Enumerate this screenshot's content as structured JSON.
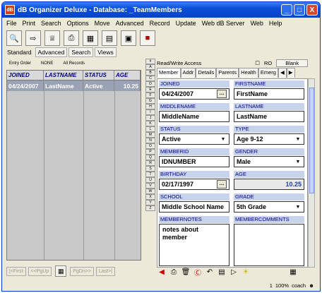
{
  "app": {
    "title": "dB Organizer Deluxe - Database: _TeamMembers",
    "minimize": "_",
    "maximize": "□",
    "close": "X",
    "icon": "app-icon"
  },
  "menu": [
    "File",
    "Print",
    "Search",
    "Options",
    "Move",
    "Advanced",
    "Record",
    "Update",
    "Web dB Server",
    "Web",
    "Help"
  ],
  "toolbar": [
    "search-icon",
    "open-icon",
    "team-icon",
    "print-icon",
    "table-icon",
    "card-icon",
    "chart-icon",
    "exit-icon"
  ],
  "viewtabs": [
    "Standard",
    "Advanced",
    "Search",
    "Views"
  ],
  "sortbar": {
    "entry": "Entry Order",
    "none": "NONE",
    "all": "All Records"
  },
  "grid": {
    "headers": [
      "JOINED",
      "LASTNAME",
      "STATUS",
      "AGE"
    ],
    "rows": [
      [
        "04/24/2007",
        "LastName",
        "Active",
        "10.25"
      ]
    ]
  },
  "nav": {
    "first": "|<First",
    "pgup": "<<PgUp",
    "pgdn": "PgDn>>",
    "last": "Last>|"
  },
  "alpha": [
    "#",
    "A",
    "B",
    "C",
    "D",
    "E",
    "F",
    "G",
    "H",
    "I",
    "J",
    "K",
    "L",
    "M",
    "N",
    "O",
    "P",
    "Q",
    "R",
    "S",
    "T",
    "U",
    "V",
    "W",
    "X",
    "Y",
    "Z"
  ],
  "rwbar": {
    "access": "Read/Write Access",
    "ro": "RO",
    "blank": "Blank"
  },
  "formtabs": [
    "Member",
    "Addr",
    "Details",
    "Parents",
    "Health",
    "Emerg"
  ],
  "form": {
    "joined_label": "JOINED",
    "joined": "04/24/2007",
    "firstname_label": "FIRSTNAME",
    "firstname": "FirstName",
    "middlename_label": "MIDDLENAME",
    "middlename": "MiddleName",
    "lastname_label": "LASTNAME",
    "lastname": "LastName",
    "status_label": "STATUS",
    "status": "Active",
    "type_label": "TYPE",
    "type": "Age 9-12",
    "memberid_label": "MEMBERID",
    "memberid": "IDNUMBER",
    "gender_label": "GENDER",
    "gender": "Male",
    "birthday_label": "BIRTHDAY",
    "birthday": "02/17/1997",
    "age_label": "AGE",
    "age": "10.25",
    "school_label": "SCHOOL",
    "school": "Middle School Name",
    "grade_label": "GRADE",
    "grade": "5th Grade",
    "notes_label": "MEMBERNOTES",
    "notes": "notes about\nmember",
    "comments_label": "MEMBERCOMMENTS",
    "comments": ""
  },
  "status": {
    "zoom": "1",
    "pct": "100%",
    "user": "coach"
  }
}
